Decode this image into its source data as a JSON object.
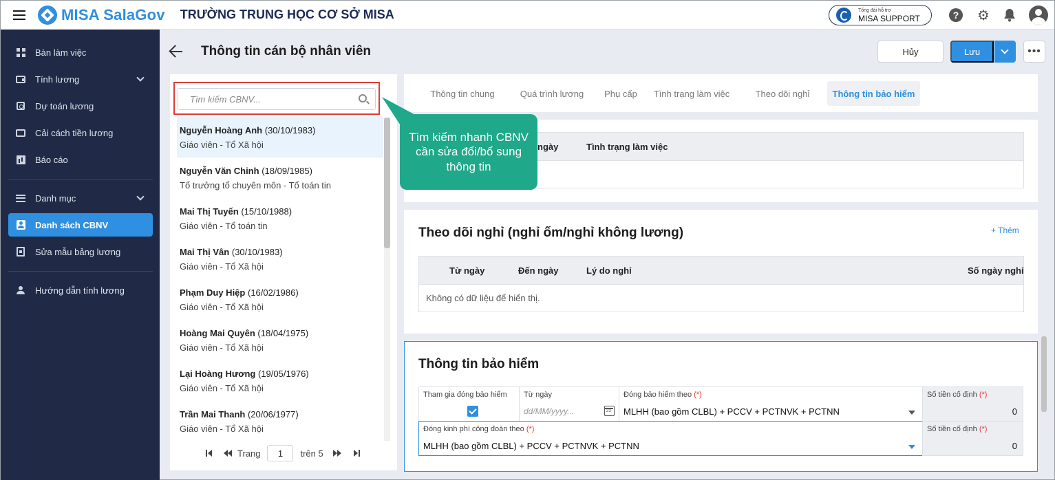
{
  "header": {
    "brand": "MISA SalaGov",
    "school": "TRƯỜNG TRUNG HỌC CƠ SỞ MISA",
    "support_small": "Tổng đài hỗ trợ",
    "support_label": "MISA SUPPORT",
    "help_glyph": "?",
    "gear_glyph": "⚙",
    "bell_glyph": "🔔"
  },
  "sidebar": {
    "items": [
      {
        "label": "Bàn làm việc",
        "icon": "dashboard-icon"
      },
      {
        "label": "Tính lương",
        "icon": "wallet-icon"
      },
      {
        "label": "Dự toán lương",
        "icon": "estimate-icon"
      },
      {
        "label": "Cải cách tiền lương",
        "icon": "card-icon"
      },
      {
        "label": "Báo cáo",
        "icon": "report-icon"
      },
      {
        "label": "Danh mục",
        "icon": "list-icon"
      },
      {
        "label": "Danh sách CBNV",
        "icon": "person-icon"
      },
      {
        "label": "Sửa mẫu bảng lương",
        "icon": "template-icon"
      },
      {
        "label": "Hướng dẫn tính lương",
        "icon": "guide-icon"
      }
    ]
  },
  "page": {
    "title": "Thông tin cán bộ nhân viên",
    "cancel_label": "Hủy",
    "save_label": "Lưu",
    "more_label": "•••"
  },
  "search": {
    "placeholder": "Tìm kiếm CBNV..."
  },
  "employees": [
    {
      "name": "Nguyễn Hoàng Anh",
      "dob": "(30/10/1983)",
      "role": "Giáo viên - Tổ Xã hội"
    },
    {
      "name": "Nguyễn Văn Chinh",
      "dob": "(18/09/1985)",
      "role": "Tổ trưởng tổ chuyên môn - Tổ toán tin"
    },
    {
      "name": "Mai Thị Tuyến",
      "dob": "(15/10/1988)",
      "role": "Giáo viên - Tổ toán tin"
    },
    {
      "name": "Mai Thị Vân",
      "dob": "(30/10/1983)",
      "role": "Giáo viên - Tổ Xã hội"
    },
    {
      "name": "Phạm Duy Hiệp",
      "dob": "(16/02/1986)",
      "role": "Giáo viên - Tổ Xã hội"
    },
    {
      "name": "Hoàng Mai Quyên",
      "dob": "(18/04/1975)",
      "role": "Giáo viên - Tổ Xã hội"
    },
    {
      "name": "Lại Hoàng Hương",
      "dob": "(19/05/1976)",
      "role": "Giáo viên - Tổ Xã hội"
    },
    {
      "name": "Trần Mai Thanh",
      "dob": "(20/06/1977)",
      "role": "Giáo viên - Tổ Xã hội"
    }
  ],
  "pager": {
    "label_page": "Trang",
    "current": "1",
    "label_of": "trên 5"
  },
  "tabs": [
    {
      "label": "Thông tin chung"
    },
    {
      "label": "Quá trình lương"
    },
    {
      "label": "Phụ cấp"
    },
    {
      "label": "Tình trạng làm việc"
    },
    {
      "label": "Theo dõi nghỉ"
    },
    {
      "label": "Thông tin bảo hiểm"
    }
  ],
  "status_card": {
    "col_date_partial": "ngày",
    "col_status": "Tình trạng làm việc"
  },
  "leave_card": {
    "title": "Theo dõi nghỉ (nghỉ ốm/nghỉ không lương)",
    "add_label": "+ Thêm",
    "columns": [
      "Từ ngày",
      "Đến ngày",
      "Lý do nghỉ",
      "Số ngày nghỉ"
    ],
    "empty": "Không có dữ liệu để hiển thị."
  },
  "insurance": {
    "title": "Thông tin bảo hiểm",
    "join_label": "Tham gia đóng bảo hiểm",
    "from_label": "Từ ngày",
    "from_placeholder": "dd/MM/yyyy...",
    "basis_label": "Đóng bảo hiểm theo",
    "basis_value": "MLHH (bao gồm CLBL) + PCCV + PCTNVK + PCTNN",
    "fixed_label": "Số tiền cố định",
    "fixed_value": "0",
    "union_label": "Đóng kinh phí công đoàn theo",
    "union_value": "MLHH (bao gồm CLBL) + PCCV + PCTNVK + PCTNN",
    "fixed2_label": "Số tiền cố định",
    "fixed2_value": "0",
    "required_mark": "(*)"
  },
  "callout": {
    "text": "Tìm kiếm nhanh CBNV cần sửa đổi/bổ sung thông tin"
  },
  "colors": {
    "accent": "#2f8fe0",
    "sidebar": "#202a46",
    "callout": "#1fa88a",
    "highlight": "#e53935"
  }
}
